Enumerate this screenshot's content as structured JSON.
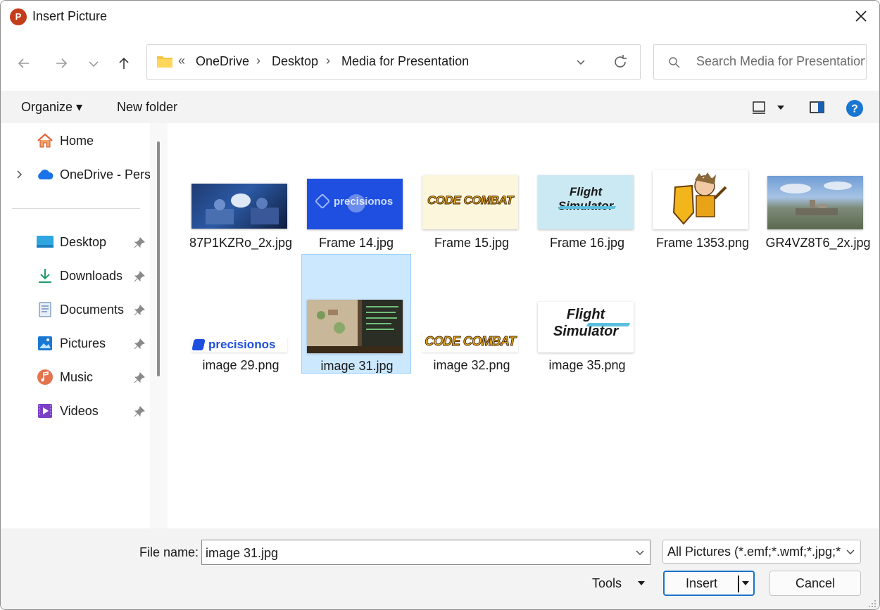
{
  "window": {
    "title": "Insert Picture",
    "app_icon_letter": "P"
  },
  "navigation": {
    "back_icon": "arrow-left-icon",
    "forward_icon": "arrow-right-icon",
    "recent_icon": "chevron-down-icon",
    "up_icon": "arrow-up-icon"
  },
  "address": {
    "overflow": "«",
    "breadcrumbs": [
      "OneDrive",
      "Desktop",
      "Media for Presentation"
    ],
    "separator": "›"
  },
  "search": {
    "placeholder": "Search Media for Presentation"
  },
  "commands": {
    "organize": "Organize ▾",
    "new_folder": "New folder"
  },
  "sidebar": {
    "items": [
      {
        "label": "Home",
        "icon": "home-icon"
      },
      {
        "label": "OneDrive - Personal",
        "icon": "onedrive-cloud-icon"
      },
      {
        "label": "Desktop",
        "icon": "desktop-icon",
        "pinned": true
      },
      {
        "label": "Downloads",
        "icon": "download-icon",
        "pinned": true
      },
      {
        "label": "Documents",
        "icon": "document-icon",
        "pinned": true
      },
      {
        "label": "Pictures",
        "icon": "picture-icon",
        "pinned": true
      },
      {
        "label": "Music",
        "icon": "music-icon",
        "pinned": true
      },
      {
        "label": "Videos",
        "icon": "video-icon",
        "pinned": true
      }
    ]
  },
  "files": [
    {
      "name": "87P1KZRo_2x.jpg",
      "thumb": "vr-surgery-scene"
    },
    {
      "name": "Frame 14.jpg",
      "thumb": "precisionos-blue",
      "thumb_text": "precisionos"
    },
    {
      "name": "Frame 15.jpg",
      "thumb": "codecombat-logo",
      "thumb_text": "CODE COMBAT"
    },
    {
      "name": "Frame 16.jpg",
      "thumb": "flight-simulator-logo",
      "thumb_text": "Flight Simulator"
    },
    {
      "name": "Frame 1353.png",
      "thumb": "knight-character"
    },
    {
      "name": "GR4VZ8T6_2x.jpg",
      "thumb": "aerial-city"
    },
    {
      "name": "image 29.png",
      "thumb": "precisionos-white",
      "thumb_text": "precisionos"
    },
    {
      "name": "image 31.jpg",
      "thumb": "game-screenshot",
      "selected": true
    },
    {
      "name": "image 32.png",
      "thumb": "codecombat-logo",
      "thumb_text": "CODE COMBAT"
    },
    {
      "name": "image 35.png",
      "thumb": "flight-simulator-logo",
      "thumb_text": "Flight Simulator"
    }
  ],
  "footer": {
    "file_name_label": "File name:",
    "file_name_value": "image 31.jpg",
    "file_type": "All Pictures (*.emf;*.wmf;*.jpg;*",
    "tools_label": "Tools",
    "insert_label": "Insert",
    "cancel_label": "Cancel"
  },
  "colors": {
    "accent": "#1a73c7",
    "selection": "#cce8ff",
    "command_bar": "#f3f3f3"
  }
}
